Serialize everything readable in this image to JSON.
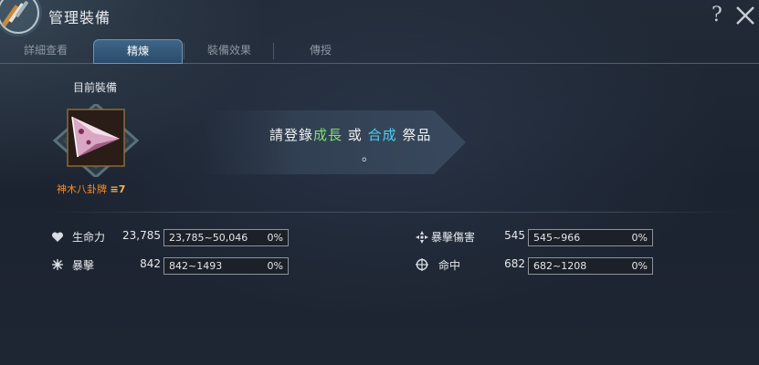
{
  "window": {
    "title": "管理裝備",
    "help_label": "?"
  },
  "tabs": [
    {
      "label": "詳細查看",
      "active": false
    },
    {
      "label": "精煉",
      "active": true
    },
    {
      "label": "裝備效果",
      "active": false
    },
    {
      "label": "傳授",
      "active": false
    }
  ],
  "equipment": {
    "section_label": "目前裝備",
    "item_name": "神木八卦牌",
    "item_level": "≡7",
    "item_name_color": "#ff8a1e"
  },
  "message": {
    "part1": "請登錄",
    "growth": "成長",
    "or": " 或 ",
    "synth": "合成",
    "part2": " 祭品",
    "period": "。"
  },
  "stats": [
    {
      "icon": "heart-icon",
      "label": "生命力",
      "value": "23,785",
      "range": "23,785~50,046",
      "percent": "0%"
    },
    {
      "icon": "critical-icon",
      "label": "暴擊",
      "value": "842",
      "range": "842~1493",
      "percent": "0%"
    },
    {
      "icon": "critical-damage-icon",
      "label": "暴擊傷害",
      "value": "545",
      "range": "545~966",
      "percent": "0%"
    },
    {
      "icon": "accuracy-icon",
      "label": "命中",
      "value": "682",
      "range": "682~1208",
      "percent": "0%"
    }
  ]
}
